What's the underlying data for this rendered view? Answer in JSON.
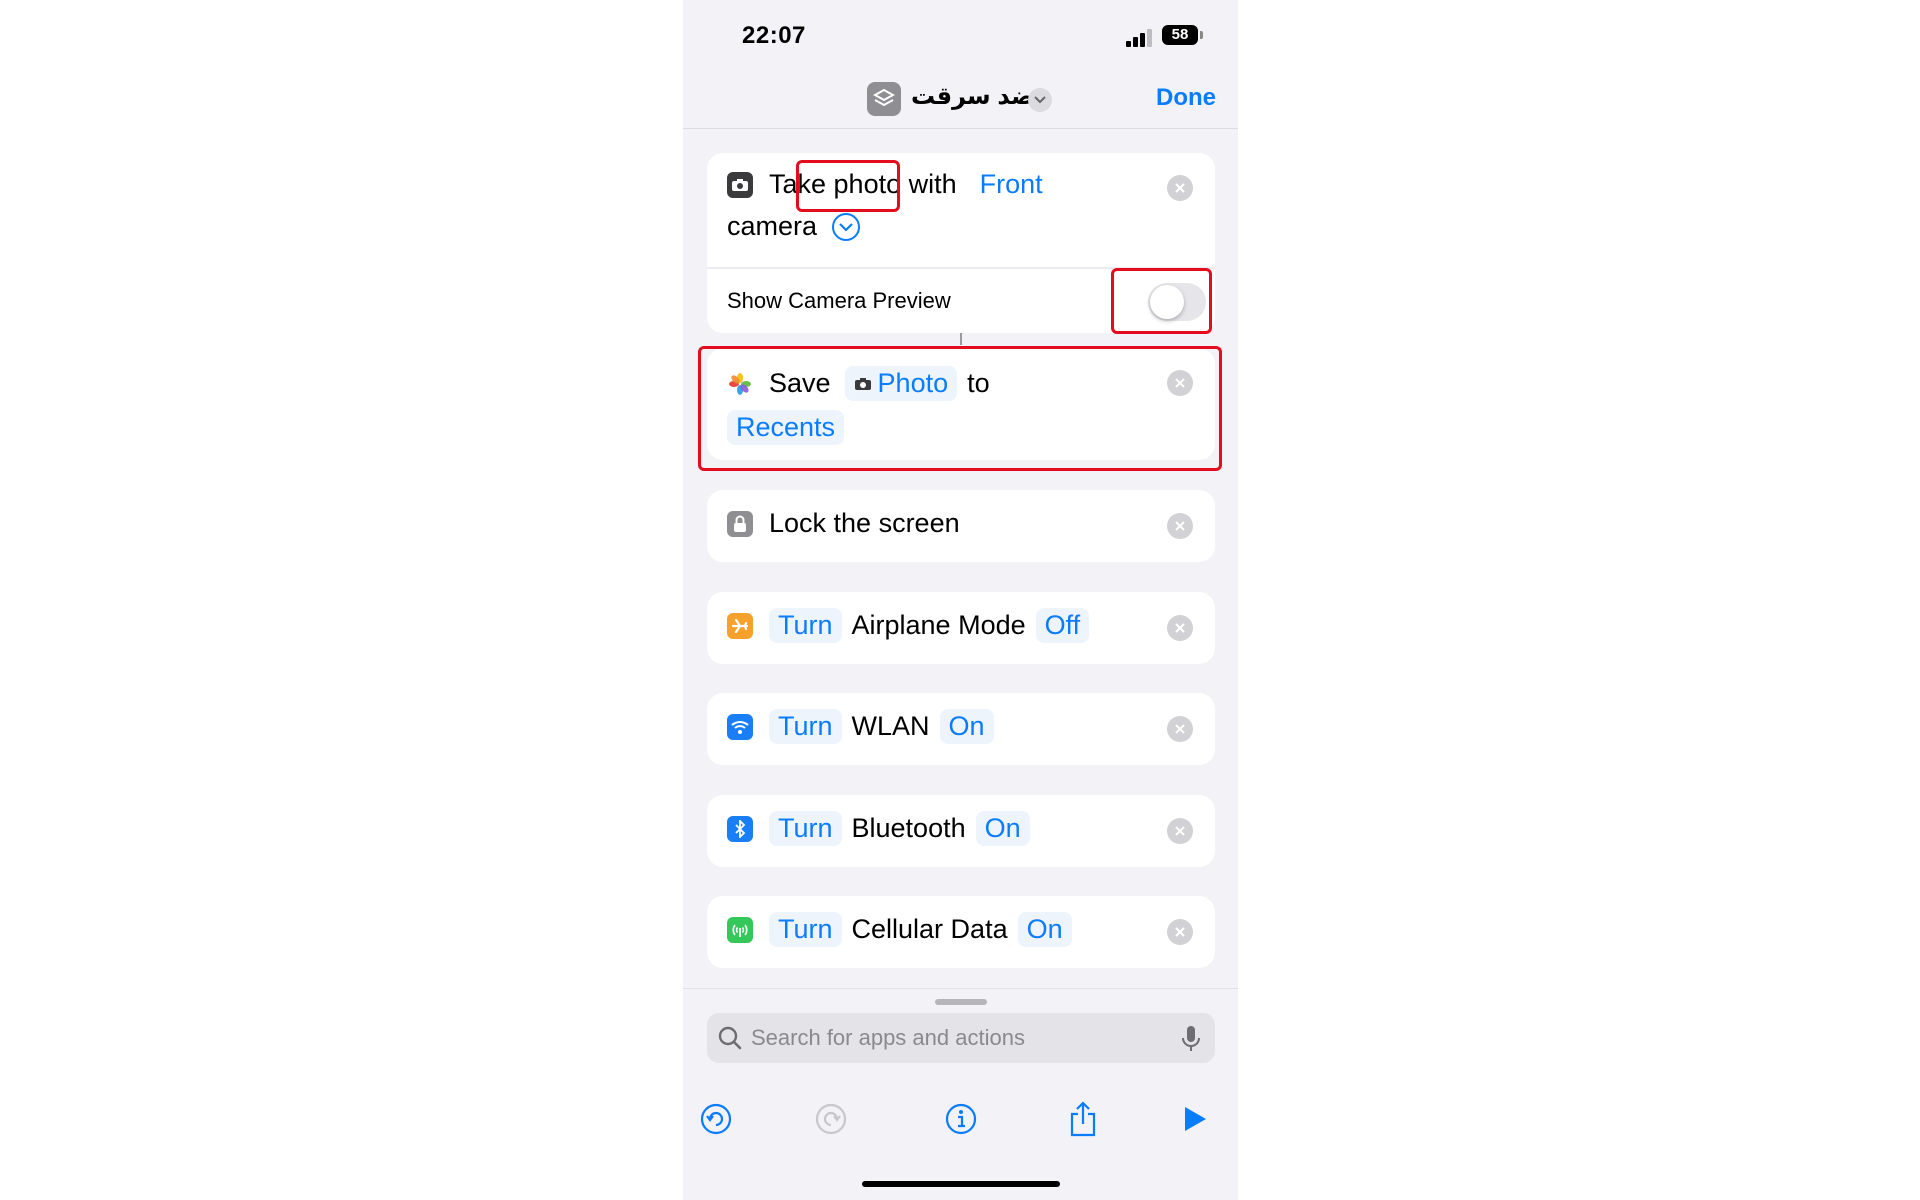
{
  "status": {
    "time": "22:07",
    "battery": "58"
  },
  "nav": {
    "title": "ضد سرقت",
    "done_label": "Done"
  },
  "actions": {
    "take_photo": {
      "prefix": "Take photo with",
      "camera_value": "Front",
      "suffix": "camera",
      "show_preview_label": "Show Camera Preview",
      "show_preview_on": false
    },
    "save": {
      "verb": "Save",
      "photo_token": "Photo",
      "to": "to",
      "album": "Recents"
    },
    "lock": {
      "label": "Lock the screen"
    },
    "airplane": {
      "verb": "Turn",
      "name": "Airplane Mode",
      "state": "Off"
    },
    "wlan": {
      "verb": "Turn",
      "name": "WLAN",
      "state": "On"
    },
    "bluetooth": {
      "verb": "Turn",
      "name": "Bluetooth",
      "state": "On"
    },
    "cellular": {
      "verb": "Turn",
      "name": "Cellular Data",
      "state": "On"
    }
  },
  "search": {
    "placeholder": "Search for apps and actions"
  },
  "colors": {
    "accent": "#0a7cff",
    "highlight": "#e30d1f",
    "airplane": "#f7a12d",
    "wifi": "#1a7ff6",
    "bluetooth": "#1a7ff6",
    "cellular": "#34c759"
  }
}
